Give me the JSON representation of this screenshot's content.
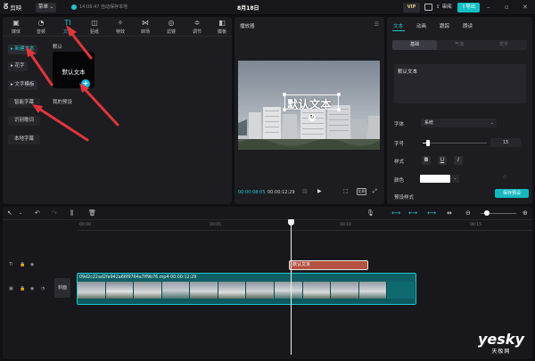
{
  "titlebar": {
    "logo_text": "剪映",
    "menu_label": "菜单",
    "save_status": "14:06:47 自动保存本地",
    "project_title": "8月18日",
    "vip_label": "VIP",
    "review_label": "审阅",
    "export_label": "导出"
  },
  "tool_tabs": [
    {
      "label": "媒体",
      "icon": "media-icon",
      "glyph": "▣"
    },
    {
      "label": "音频",
      "icon": "audio-icon",
      "glyph": "◔"
    },
    {
      "label": "文本",
      "icon": "text-icon",
      "glyph": "TI"
    },
    {
      "label": "贴纸",
      "icon": "sticker-icon",
      "glyph": "◫"
    },
    {
      "label": "特效",
      "icon": "effects-icon",
      "glyph": "✧"
    },
    {
      "label": "转场",
      "icon": "transition-icon",
      "glyph": "⋈"
    },
    {
      "label": "滤镜",
      "icon": "filter-icon",
      "glyph": "◎"
    },
    {
      "label": "调节",
      "icon": "adjust-icon",
      "glyph": "≑"
    },
    {
      "label": "模板",
      "icon": "template-icon",
      "glyph": "◧"
    }
  ],
  "sidebar": {
    "items": [
      {
        "label": "▸ 新建文本",
        "active": true
      },
      {
        "label": "▸ 花字",
        "active": false
      },
      {
        "label": "▸ 文字模板",
        "active": false
      },
      {
        "label": "智能字幕",
        "active": false
      },
      {
        "label": "识别歌词",
        "active": false
      },
      {
        "label": "本地字幕",
        "active": false
      }
    ]
  },
  "text_library": {
    "section_default": "默认",
    "default_card_text": "默认文本",
    "section_presets": "我的预设"
  },
  "player": {
    "title": "播放器",
    "overlay_text": "默认文本",
    "time_current": "00:00:08:05",
    "time_total": "00:00:12:29",
    "ratio_label": "比例"
  },
  "properties": {
    "tabs": [
      "文本",
      "动画",
      "跟踪",
      "朗读"
    ],
    "active_tab": "文本",
    "subtabs": [
      "基础",
      "气泡",
      "花字"
    ],
    "text_value": "默认文本",
    "font_label": "字体",
    "font_value": "系统",
    "size_label": "字号",
    "size_value": "15",
    "size_fraction": 0.05,
    "style_label": "样式",
    "style_buttons": [
      "B",
      "U",
      "I"
    ],
    "color_label": "颜色",
    "color_value": "#ffffff",
    "preset_label": "预设样式",
    "save_preset_label": "保存预设"
  },
  "timeline": {
    "ticks": [
      "00:00",
      "00:05",
      "00:10",
      "00:15"
    ],
    "cover_label": "封面",
    "text_clip_label": "默认文本",
    "video_clip_label": "09d2c22ad2fa942a66f9764a7ff9b76.mp4  00:00:12:29"
  },
  "colors": {
    "accent": "#22c6cb",
    "text_clip": "#b35240",
    "video_clip": "#0f6a70",
    "annotation_arrow": "#e0363a"
  },
  "watermark": {
    "main": "yesky",
    "sub": "天极网"
  }
}
